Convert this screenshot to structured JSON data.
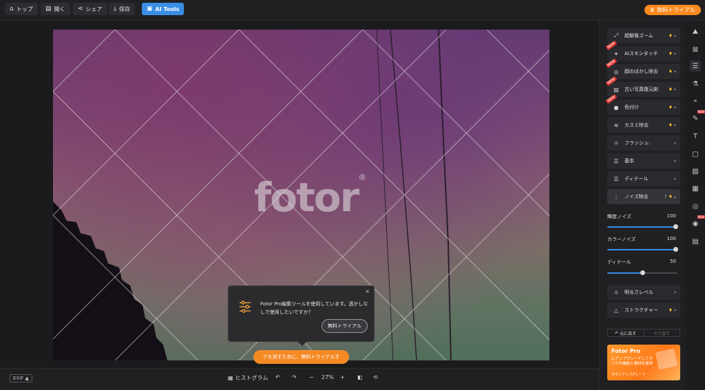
{
  "topbar": {
    "home_label": "トップ",
    "open_label": "開く",
    "share_label": "シェア",
    "save_label": "保存",
    "ai_tools_label": "AI Tools",
    "trial_label": "無料トライアル"
  },
  "canvas": {
    "watermark": "fotor",
    "watermark_mark": "®"
  },
  "popup": {
    "message": "Fotor Pro編集ツールを使用しています。透かしなしで使用したいですか？",
    "button_label": "無料トライアル",
    "close_label": "×"
  },
  "remove_watermark_label": "クを消すために、無料トライアルす",
  "bottombar": {
    "exif_label": "EXIF ▲",
    "histogram_label": "ヒストグラム",
    "zoom_value": "27%"
  },
  "panel": {
    "tools": [
      {
        "label": "超解像ズーム",
        "icon": "super-resolution-icon",
        "pro": true,
        "new": false
      },
      {
        "label": "AIスキンタッチ",
        "icon": "ai-skin-icon",
        "pro": true,
        "new": true
      },
      {
        "label": "顔のぼかし除去",
        "icon": "face-deblur-icon",
        "pro": true,
        "new": true
      },
      {
        "label": "古い写真復元剤",
        "icon": "photo-restore-icon",
        "pro": true,
        "new": true
      },
      {
        "label": "色付け",
        "icon": "colorize-icon",
        "pro": true,
        "new": true
      },
      {
        "label": "カスミ除去",
        "icon": "dehaze-icon",
        "pro": true,
        "new": false
      },
      {
        "label": "フラッシュ:",
        "icon": "flash-icon",
        "pro": false,
        "new": false
      },
      {
        "label": "基本",
        "icon": "basic-icon",
        "pro": false,
        "new": false
      },
      {
        "label": "ディテール",
        "icon": "detail-icon",
        "pro": false,
        "new": false
      },
      {
        "label": "ノイズ除去",
        "icon": "denoise-icon",
        "pro": true,
        "new": false
      }
    ],
    "sliders": [
      {
        "label": "輝度ノイズ",
        "value": 100,
        "max": 100
      },
      {
        "label": "カラーノイズ",
        "value": 100,
        "max": 100
      },
      {
        "label": "ディテール",
        "value": 50,
        "max": 100
      }
    ],
    "tools_lower": [
      {
        "label": "明るさレベル",
        "icon": "brightness-icon"
      },
      {
        "label": "ストラクチャー",
        "icon": "structure-icon"
      }
    ],
    "undo_label": "元に戻す",
    "redo_label": "やり直す",
    "promo": {
      "title": "Fotor Pro",
      "desc": "にアップグレードしてすべての機能と素材を使用",
      "link": "今すぐアップグレード"
    }
  },
  "colors": {
    "accent": "#3a8ee6",
    "orange": "#ff8a1f",
    "pro_gem": "#f6b62a"
  }
}
